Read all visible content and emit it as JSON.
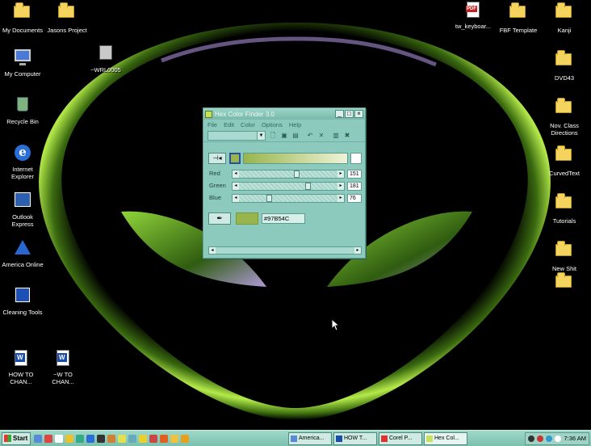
{
  "desktop": {
    "icons_left": [
      {
        "label": "My Documents",
        "icon": "folder-icon"
      },
      {
        "label": "My Computer",
        "icon": "computer-icon"
      },
      {
        "label": "Recycle Bin",
        "icon": "recycle-bin-icon"
      },
      {
        "label": "Internet Explorer",
        "icon": "internet-explorer-icon"
      },
      {
        "label": "Outlook Express",
        "icon": "outlook-express-icon"
      },
      {
        "label": "America Online",
        "icon": "aol-icon"
      },
      {
        "label": "Cleaning Tools",
        "icon": "cleaning-tools-icon"
      },
      {
        "label": "HOW TO CHAN...",
        "icon": "word-document-icon"
      }
    ],
    "icons_middle": [
      {
        "label": "Jasons Project",
        "icon": "folder-icon"
      },
      {
        "label": "~WRL0005",
        "icon": "temp-file-icon"
      },
      {
        "label": "~W TO CHAN...",
        "icon": "word-document-icon"
      }
    ],
    "icons_right": [
      {
        "label": "tw_keyboar...",
        "icon": "pdf-document-icon"
      },
      {
        "label": "FBF Template",
        "icon": "folder-icon"
      },
      {
        "label": "Kanji",
        "icon": "folder-icon"
      },
      {
        "label": "DVD43",
        "icon": "folder-icon"
      },
      {
        "label": "Nov. Class Directions",
        "icon": "folder-icon"
      },
      {
        "label": "CurvedText",
        "icon": "folder-icon"
      },
      {
        "label": "Tutorials",
        "icon": "folder-icon"
      },
      {
        "label": "New Shit",
        "icon": "folder-icon"
      },
      {
        "label": "",
        "icon": "folder-icon"
      }
    ]
  },
  "window": {
    "title": "Hex Color Finder 3.0",
    "controls": {
      "minimize": "_",
      "maximize": "□",
      "close": "×"
    },
    "menu": [
      "File",
      "Edit",
      "Color",
      "Options",
      "Help"
    ],
    "toolbar": {
      "combo_value": "",
      "tools": [
        "new-icon",
        "open-icon",
        "save-icon",
        "undo-icon",
        "cut-icon",
        "paste-icon",
        "delete-icon"
      ]
    },
    "sliders": [
      {
        "label": "Red",
        "value": "151",
        "level": 151
      },
      {
        "label": "Green",
        "value": "181",
        "level": 181
      },
      {
        "label": "Blue",
        "value": "76",
        "level": 76
      }
    ],
    "hex_value": "#97B54C",
    "colors": {
      "picked": "#97B54C"
    }
  },
  "taskbar": {
    "start_label": "Start",
    "tasks": [
      {
        "label": "America..."
      },
      {
        "label": "HOW T..."
      },
      {
        "label": "Corel P..."
      },
      {
        "label": "Hex Col..."
      }
    ],
    "clock": "7:36 AM"
  }
}
